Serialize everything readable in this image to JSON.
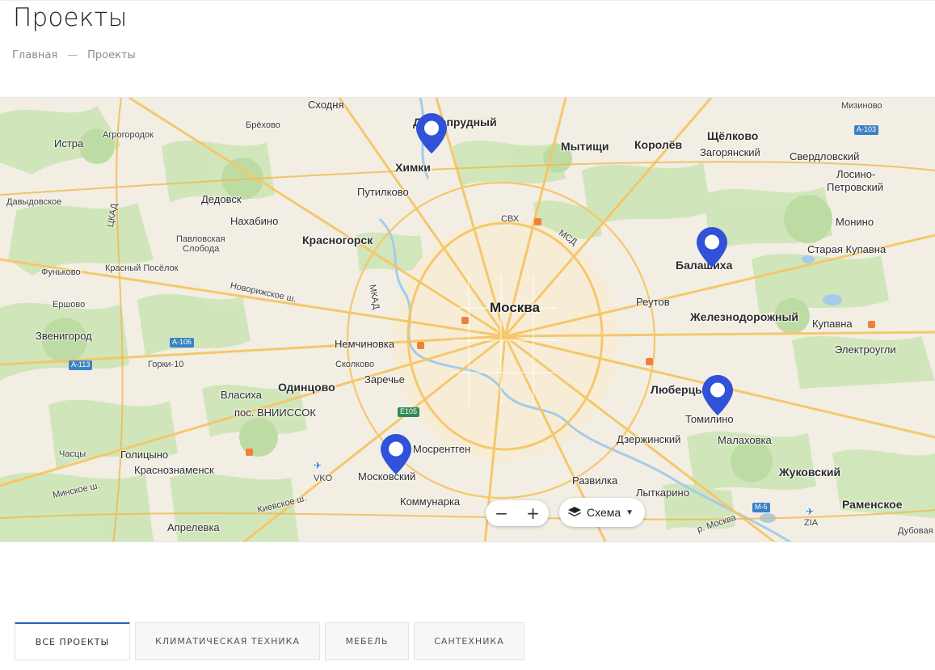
{
  "page": {
    "title": "Проекты"
  },
  "breadcrumb": {
    "home": "Главная",
    "separator": "—",
    "current": "Проекты"
  },
  "map": {
    "places": [
      {
        "t": "Сходня",
        "c": "mid"
      },
      {
        "t": "Долгопрудный",
        "c": "big"
      },
      {
        "t": "Мизиново",
        "c": "small"
      },
      {
        "t": "Брёхово",
        "c": "small"
      },
      {
        "t": "Агрогородок",
        "c": "small"
      },
      {
        "t": "Истра",
        "c": "mid"
      },
      {
        "t": "Химки",
        "c": "big"
      },
      {
        "t": "Мытищи",
        "c": "big"
      },
      {
        "t": "Королёв",
        "c": "big"
      },
      {
        "t": "Щёлково",
        "c": "big"
      },
      {
        "t": "Загорянский",
        "c": "mid"
      },
      {
        "t": "Свердловский",
        "c": "mid"
      },
      {
        "t": "Лосино-",
        "c": "mid"
      },
      {
        "t": "Петровский",
        "c": "mid"
      },
      {
        "t": "Путилково",
        "c": "mid"
      },
      {
        "t": "Дедовск",
        "c": "mid"
      },
      {
        "t": "Давыдовское",
        "c": "small"
      },
      {
        "t": "Нахабино",
        "c": "mid"
      },
      {
        "t": "Красногорск",
        "c": "big"
      },
      {
        "t": "Павловская",
        "c": "small"
      },
      {
        "t": "Слобода",
        "c": "small"
      },
      {
        "t": "Монино",
        "c": "mid"
      },
      {
        "t": "Балашиха",
        "c": "big"
      },
      {
        "t": "Старая Купавна",
        "c": "mid"
      },
      {
        "t": "Фуньково",
        "c": "small"
      },
      {
        "t": "Красный Посёлок",
        "c": "small"
      },
      {
        "t": "Новорижское ш.",
        "c": "small"
      },
      {
        "t": "Ершово",
        "c": "small"
      },
      {
        "t": "Москва",
        "c": "capital"
      },
      {
        "t": "Реутов",
        "c": "mid"
      },
      {
        "t": "Железнодорожный",
        "c": "big"
      },
      {
        "t": "Звенигород",
        "c": "mid"
      },
      {
        "t": "Немчиновка",
        "c": "mid"
      },
      {
        "t": "Купавна",
        "c": "mid"
      },
      {
        "t": "Электроугли",
        "c": "mid"
      },
      {
        "t": "Горки-10",
        "c": "small"
      },
      {
        "t": "Заречье",
        "c": "mid"
      },
      {
        "t": "Одинцово",
        "c": "big"
      },
      {
        "t": "Люберцы",
        "c": "big"
      },
      {
        "t": "Власиха",
        "c": "mid"
      },
      {
        "t": "пос. ВНИИССОК",
        "c": "mid"
      },
      {
        "t": "Томилино",
        "c": "mid"
      },
      {
        "t": "Дзержинский",
        "c": "mid"
      },
      {
        "t": "Малаховка",
        "c": "mid"
      },
      {
        "t": "Мосрентген",
        "c": "mid"
      },
      {
        "t": "Часцы",
        "c": "small"
      },
      {
        "t": "Голицыно",
        "c": "mid"
      },
      {
        "t": "Краснознаменск",
        "c": "mid"
      },
      {
        "t": "Московский",
        "c": "mid"
      },
      {
        "t": "Жуковский",
        "c": "big"
      },
      {
        "t": "Развилка",
        "c": "mid"
      },
      {
        "t": "Минское ш.",
        "c": "small"
      },
      {
        "t": "Коммунарка",
        "c": "mid"
      },
      {
        "t": "Лыткарино",
        "c": "mid"
      },
      {
        "t": "Раменское",
        "c": "big"
      },
      {
        "t": "Киевское ш.",
        "c": "small"
      },
      {
        "t": "Апрелевка",
        "c": "mid"
      },
      {
        "t": "Дубовая",
        "c": "small"
      },
      {
        "t": "р. Москва",
        "c": "small"
      },
      {
        "t": "ЦКАД",
        "c": "small"
      },
      {
        "t": "МКАД",
        "c": "small"
      },
      {
        "t": "СВХ",
        "c": "small"
      },
      {
        "t": "МСД",
        "c": "small"
      },
      {
        "t": "Сколково",
        "c": "small"
      }
    ],
    "road_badges": [
      "A-103",
      "A-106",
      "A-113",
      "E105",
      "M-5"
    ],
    "airports": [
      "VKO",
      "ZIA"
    ],
    "zoom": {
      "out": "−",
      "in": "+"
    },
    "layers_label": "Схема",
    "marker_color": "#2f52d8"
  },
  "tabs": [
    {
      "label": "ВСЕ ПРОЕКТЫ",
      "active": true
    },
    {
      "label": "КЛИМАТИЧЕСКАЯ ТЕХНИКА",
      "active": false
    },
    {
      "label": "МЕБЕЛЬ",
      "active": false
    },
    {
      "label": "САНТЕХНИКА",
      "active": false
    }
  ]
}
